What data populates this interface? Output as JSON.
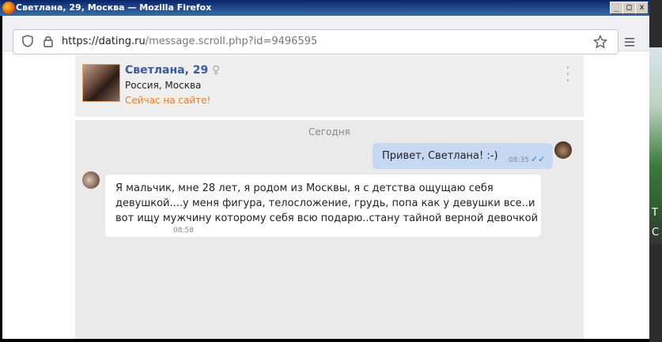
{
  "window": {
    "title": "Светлана, 29, Москва — Mozilla Firefox",
    "minimize_label": "_",
    "maximize_label": "□",
    "close_label": "x"
  },
  "browser": {
    "url_host": "https://dating.ru",
    "url_path": "/message.scroll.php?id=9496595",
    "bookmark_icon": "star-icon",
    "menu_icon": "hamburger-icon",
    "shield_icon": "shield-icon",
    "lock_icon": "lock-icon"
  },
  "profile": {
    "name": "Светлана, 29",
    "gender_symbol": "♀",
    "location": "Россия, Москва",
    "status": "Сейчас на сайте!",
    "status_color": "#f07a20"
  },
  "chat": {
    "date_separator": "Сегодня",
    "messages": [
      {
        "direction": "outgoing",
        "text": "Привет, Светлана! :-)",
        "time": "08:35",
        "read": true
      },
      {
        "direction": "incoming",
        "text": "Я мальчик, мне 28 лет, я родом из Москвы, я с детства ощущаю себя девушкой....у меня фигура, телосложение, грудь, попа как у девушки все..и вот ищу мужчину которому себя всю подарю..стану тайной верной девочкой",
        "time": "08:58"
      }
    ]
  },
  "side_strip": {
    "letters": [
      "Т",
      "С"
    ]
  }
}
